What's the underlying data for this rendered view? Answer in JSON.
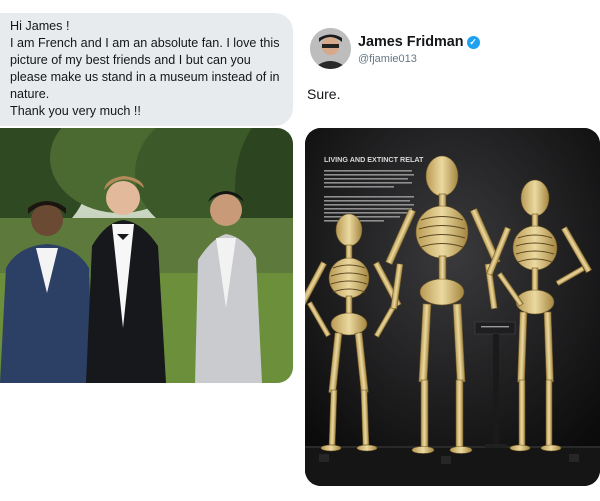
{
  "request": {
    "lines": [
      "Hi James !",
      "I am French and I am an absolute fan. I love this",
      "picture of my best friends and I but can you",
      "please make us stand in a museum instead of in",
      "nature.",
      "Thank you very much !!"
    ]
  },
  "reply": {
    "author_name": "James Fridman",
    "author_handle": "@fjamie013",
    "text": "Sure.",
    "verified_icon": "verified-badge-icon"
  },
  "museum_panel": {
    "title": "LIVING AND EXTINCT RELAT"
  },
  "colors": {
    "bubble_bg": "#e8ebee",
    "verified": "#1da1f2",
    "handle": "#657786"
  }
}
